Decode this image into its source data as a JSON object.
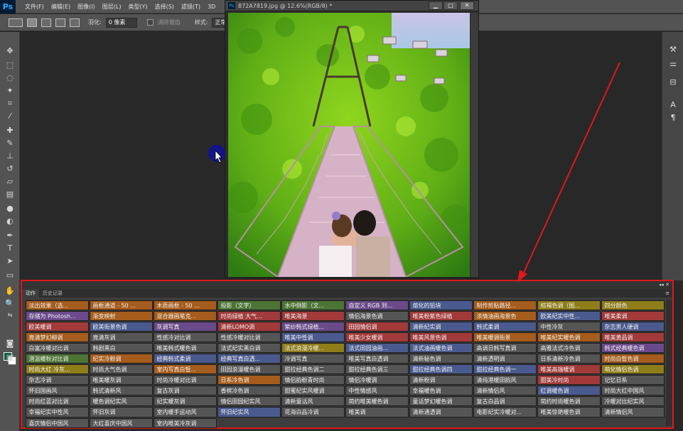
{
  "menubar": {
    "logo": "Ps",
    "items": [
      "文件(F)",
      "编辑(E)",
      "图像(I)",
      "图层(L)",
      "类型(Y)",
      "选择(S)",
      "滤镜(T)",
      "3D"
    ]
  },
  "options": {
    "feather_label": "羽化:",
    "feather_value": "0 像素",
    "antialias_label": "消除锯齿",
    "style_label": "样式:",
    "style_value": "正常"
  },
  "document": {
    "title": "872A7819.jpg @ 12.6%(RGB/8) *",
    "minimize": "▁",
    "maximize": "□",
    "close": "✕"
  },
  "panel": {
    "tabs": [
      "动作",
      "历史记录"
    ],
    "controls": "◂◂ ✕",
    "menu": "≡",
    "colors": {
      "orange": "#a55c1c",
      "red": "#a23a3a",
      "yellow": "#8f7d1a",
      "green": "#4c7434",
      "blue": "#4a5a8e",
      "violet": "#6a4a8a",
      "gray": "#555555"
    },
    "actions": [
      {
        "label": "淡出效果（选...",
        "color": "orange"
      },
      {
        "label": "画框通道 - 50 ...",
        "color": "orange"
      },
      {
        "label": "木质画框 - 50 ...",
        "color": "orange"
      },
      {
        "label": "投影（文字）",
        "color": "green"
      },
      {
        "label": "水中倒影（文...",
        "color": "green"
      },
      {
        "label": "自定义 RGB 到...",
        "color": "violet"
      },
      {
        "label": "熔化的铅块",
        "color": "blue"
      },
      {
        "label": "制作剪贴路径...",
        "color": "orange"
      },
      {
        "label": "棕褐色调（图...",
        "color": "yellow"
      },
      {
        "label": "四分颜色",
        "color": "yellow"
      },
      {
        "label": "存储为 Photosh...",
        "color": "violet"
      },
      {
        "label": "渐变映射",
        "color": "orange"
      },
      {
        "label": "混合器画笔克...",
        "color": "orange"
      },
      {
        "label": "时尚绿植 大气...",
        "color": "red"
      },
      {
        "label": "唯美海景",
        "color": "red"
      },
      {
        "label": "情侣海景色调",
        "color": "gray"
      },
      {
        "label": "唯美粉紫色绿植",
        "color": "red"
      },
      {
        "label": "浓情油画海景色",
        "color": "orange"
      },
      {
        "label": "欧美纪实中性...",
        "color": "blue"
      },
      {
        "label": "唯美柔调",
        "color": "red"
      },
      {
        "label": "欧美暖调",
        "color": "red"
      },
      {
        "label": "欧美街景色调",
        "color": "blue"
      },
      {
        "label": "灰调写真",
        "color": "violet"
      },
      {
        "label": "清新LOMO调",
        "color": "red"
      },
      {
        "label": "紫纱韩式绿植...",
        "color": "violet"
      },
      {
        "label": "田园情侣调",
        "color": "red"
      },
      {
        "label": "清新纪实调",
        "color": "blue"
      },
      {
        "label": "韩式柔调",
        "color": "blue"
      },
      {
        "label": "中性冷灰",
        "color": "gray"
      },
      {
        "label": "杂志男人硬调",
        "color": "blue"
      },
      {
        "label": "竟清梦幻柳调",
        "color": "orange"
      },
      {
        "label": "竟清灰调",
        "color": "gray"
      },
      {
        "label": "性感冷对比调",
        "color": "gray"
      },
      {
        "label": "性感冷暖对比调",
        "color": "gray"
      },
      {
        "label": "唯美中性调",
        "color": "blue"
      },
      {
        "label": "唯美少女暖调",
        "color": "red"
      },
      {
        "label": "唯美风景色调",
        "color": "red"
      },
      {
        "label": "唯美暖调街景",
        "color": "orange"
      },
      {
        "label": "唯美纪实暖色调",
        "color": "orange"
      },
      {
        "label": "唯美黄品调",
        "color": "red"
      },
      {
        "label": "白富冷暖对比调",
        "color": "gray"
      },
      {
        "label": "韩剧黑白",
        "color": "gray"
      },
      {
        "label": "唯美韩式暖色调",
        "color": "gray"
      },
      {
        "label": "法式纪实黑白调",
        "color": "gray"
      },
      {
        "label": "法式浪漫冷暖...",
        "color": "yellow"
      },
      {
        "label": "法式田园油画...",
        "color": "blue"
      },
      {
        "label": "法式油画暖色调",
        "color": "blue"
      },
      {
        "label": "高调日韩写真调",
        "color": "gray"
      },
      {
        "label": "高雅法式冷色调",
        "color": "gray"
      },
      {
        "label": "韩式经典暖色调",
        "color": "violet"
      },
      {
        "label": "测温暖秋对比调",
        "color": "green"
      },
      {
        "label": "纪实冷粉调",
        "color": "orange"
      },
      {
        "label": "经典韩式柔调",
        "color": "blue"
      },
      {
        "label": "经典写真白透...",
        "color": "blue"
      },
      {
        "label": "冷调写真",
        "color": "gray"
      },
      {
        "label": "唯美写真白透调",
        "color": "gray"
      },
      {
        "label": "清新秘色调",
        "color": "gray"
      },
      {
        "label": "清新透明调",
        "color": "gray"
      },
      {
        "label": "日系清新冷色调",
        "color": "gray"
      },
      {
        "label": "时尚白皙色调",
        "color": "orange"
      },
      {
        "label": "时尚大红 冷灰...",
        "color": "yellow"
      },
      {
        "label": "时尚大气色调",
        "color": "gray"
      },
      {
        "label": "室内写真白皙...",
        "color": "orange"
      },
      {
        "label": "田园浪漫暖色调",
        "color": "gray"
      },
      {
        "label": "甜拉经典色调二",
        "color": "gray"
      },
      {
        "label": "甜拉经典色调三",
        "color": "gray"
      },
      {
        "label": "甜拉经典色调四",
        "color": "blue"
      },
      {
        "label": "甜拉经典色调一",
        "color": "blue"
      },
      {
        "label": "唯美高端暖调",
        "color": "red"
      },
      {
        "label": "萌化情侣色调",
        "color": "yellow"
      },
      {
        "label": "杂志冷调",
        "color": "gray"
      },
      {
        "label": "唯美暖灰调",
        "color": "gray"
      },
      {
        "label": "时尚冷暖对比调",
        "color": "gray"
      },
      {
        "label": "日系冷色调",
        "color": "orange"
      },
      {
        "label": "情侣韵粉青时尚",
        "color": "gray"
      },
      {
        "label": "情侣冷暖调",
        "color": "gray"
      },
      {
        "label": "清新粉调",
        "color": "gray"
      },
      {
        "label": "清纯港暖田韵风",
        "color": "gray"
      },
      {
        "label": "甜美冷时尚",
        "color": "red"
      },
      {
        "label": "记忆日系",
        "color": "gray"
      },
      {
        "label": "怀旧国画风",
        "color": "gray"
      },
      {
        "label": "韩式清新风",
        "color": "gray"
      },
      {
        "label": "复古灰调",
        "color": "gray"
      },
      {
        "label": "香槟冷色调",
        "color": "gray"
      },
      {
        "label": "甜蜜纪实风暖调",
        "color": "gray"
      },
      {
        "label": "中性情感风",
        "color": "gray"
      },
      {
        "label": "幸福暖色调",
        "color": "gray"
      },
      {
        "label": "清新情侣风",
        "color": "gray"
      },
      {
        "label": "红调暖色调",
        "color": "blue"
      },
      {
        "label": "时尚大红中国风",
        "color": "gray"
      },
      {
        "label": "时尚红蓝对比调",
        "color": "gray"
      },
      {
        "label": "暖色调纪实风",
        "color": "gray"
      },
      {
        "label": "纪实暖灰调",
        "color": "gray"
      },
      {
        "label": "情侣田园纪实风",
        "color": "gray"
      },
      {
        "label": "清新童话风",
        "color": "gray"
      },
      {
        "label": "简约唯美暖色调",
        "color": "gray"
      },
      {
        "label": "童话梦幻暖色调",
        "color": "gray"
      },
      {
        "label": "复古白品调",
        "color": "gray"
      },
      {
        "label": "简约时尚暖色调",
        "color": "gray"
      },
      {
        "label": "冷暖对比纪实风",
        "color": "gray"
      },
      {
        "label": "幸福纪实中性风",
        "color": "gray"
      },
      {
        "label": "怀旧灰调",
        "color": "gray"
      },
      {
        "label": "室内暖手运动风",
        "color": "gray"
      },
      {
        "label": "怀旧纪实风",
        "color": "blue"
      },
      {
        "label": "花海白品冷调",
        "color": "gray"
      },
      {
        "label": "唯美调",
        "color": "gray"
      },
      {
        "label": "清新通透调",
        "color": "gray"
      },
      {
        "label": "电影纪实冷暖对...",
        "color": "gray"
      },
      {
        "label": "唯美惊艳暖色调",
        "color": "gray"
      },
      {
        "label": "清新情侣风",
        "color": "gray"
      },
      {
        "label": "喜庆情侣中国风",
        "color": "gray"
      },
      {
        "label": "大红喜庆中国风",
        "color": "gray"
      },
      {
        "label": "室内唯美冷灰调",
        "color": "gray"
      }
    ]
  }
}
